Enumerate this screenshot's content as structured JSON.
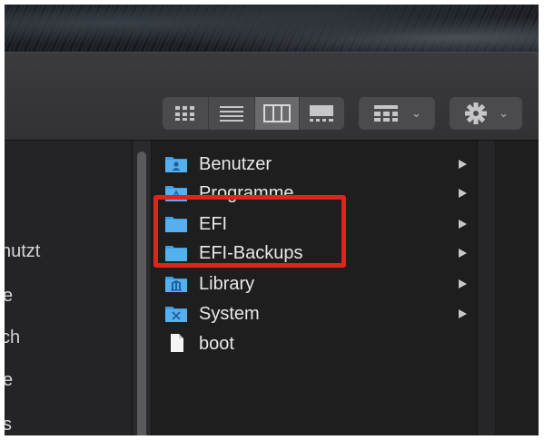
{
  "colors": {
    "accent_highlight": "#e0241b",
    "folder_blue": "#3e9fe4",
    "window_bg": "#1e1e1f",
    "toolbar_bg": "#353537"
  },
  "toolbar": {
    "view_icons": [
      "icon-view-icon",
      "list-view-icon",
      "column-view-icon",
      "gallery-view-icon"
    ],
    "active_view": "column-view-icon",
    "group_icon": "group-by-icon",
    "action_icon": "gear-icon"
  },
  "sidebar": {
    "items": [
      {
        "label": "nutzt"
      },
      {
        "label": "e"
      },
      {
        "label": "ch"
      },
      {
        "label": "e"
      },
      {
        "label": "s"
      }
    ]
  },
  "column": {
    "items": [
      {
        "label": "Benutzer",
        "icon": "users-folder-icon",
        "has_children": true
      },
      {
        "label": "Programme",
        "icon": "applications-folder-icon",
        "has_children": true
      },
      {
        "label": "EFI",
        "icon": "folder-icon",
        "has_children": true
      },
      {
        "label": "EFI-Backups",
        "icon": "folder-icon",
        "has_children": true
      },
      {
        "label": "Library",
        "icon": "library-folder-icon",
        "has_children": true
      },
      {
        "label": "System",
        "icon": "system-folder-icon",
        "has_children": true
      },
      {
        "label": "boot",
        "icon": "document-icon",
        "has_children": false
      }
    ]
  }
}
